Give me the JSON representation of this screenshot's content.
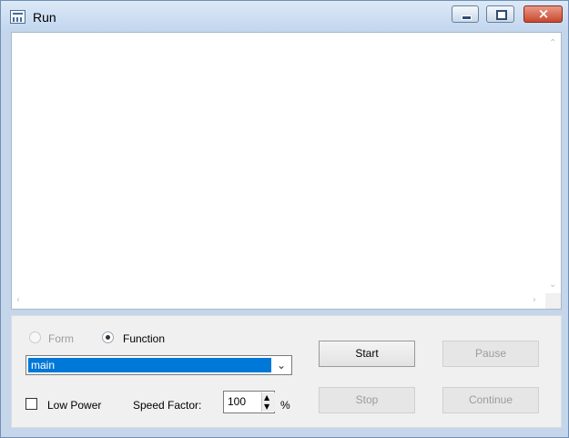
{
  "window": {
    "title": "Run"
  },
  "controls": {
    "radio_form": "Form",
    "radio_function": "Function",
    "function_select": "main",
    "low_power": "Low Power",
    "speed_factor_label": "Speed Factor:",
    "speed_value": "100",
    "percent": "%"
  },
  "buttons": {
    "start": "Start",
    "pause": "Pause",
    "stop": "Stop",
    "continue": "Continue"
  },
  "icons": {
    "minimize": "minimize-icon",
    "maximize": "maximize-icon",
    "close": "close-icon",
    "scroll_up": "chevron-up-icon",
    "scroll_down": "chevron-down-icon",
    "scroll_left": "chevron-left-icon",
    "scroll_right": "chevron-right-icon",
    "dropdown": "chevron-down-icon"
  }
}
